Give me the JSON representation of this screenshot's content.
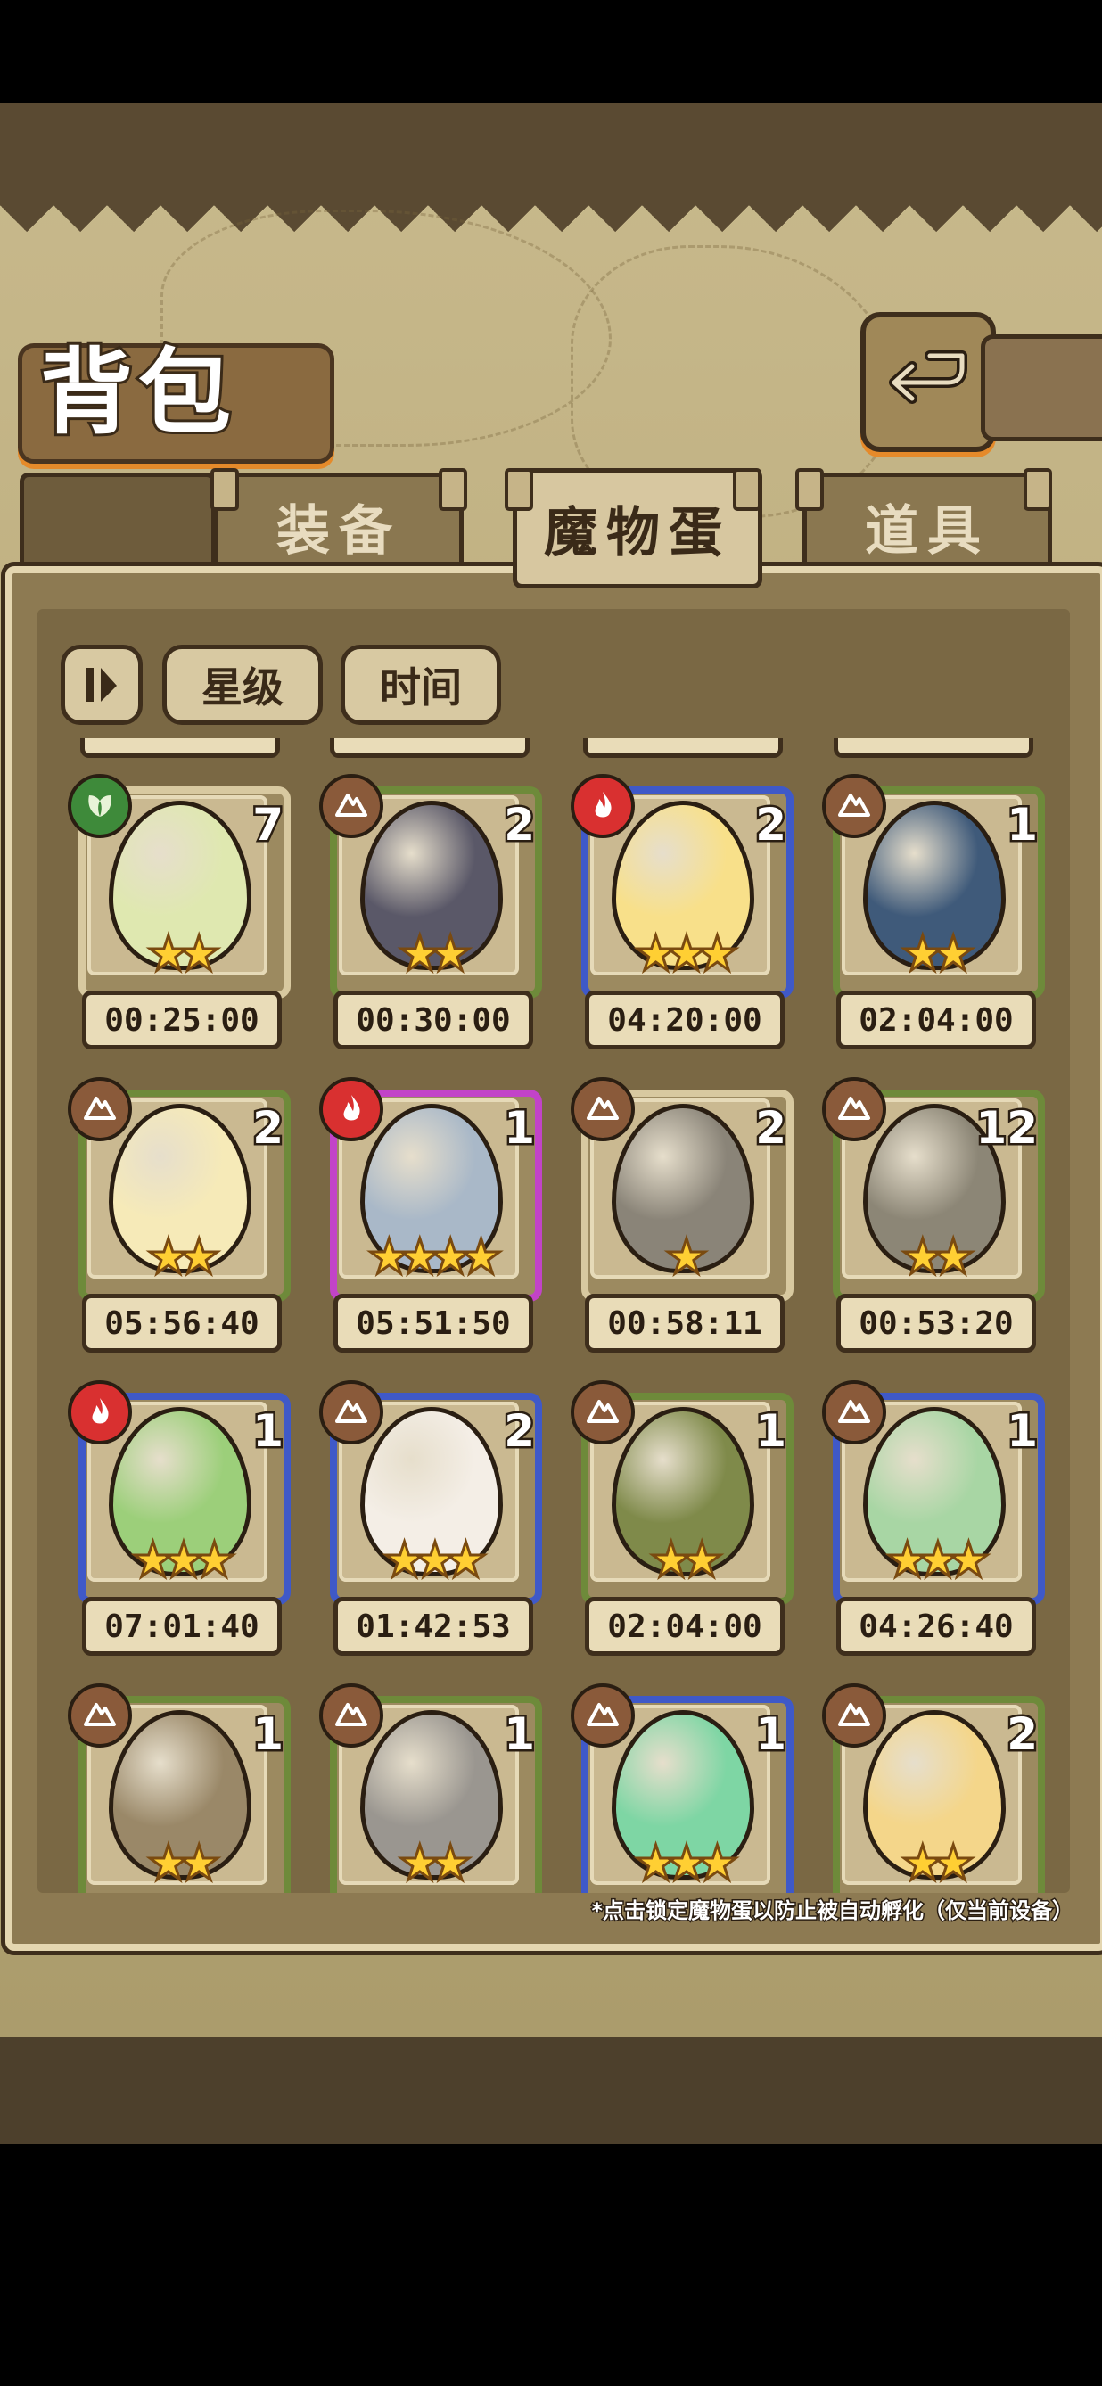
{
  "title": "背包",
  "tabs": [
    {
      "label": "装备",
      "active": false
    },
    {
      "label": "魔物蛋",
      "active": true
    },
    {
      "label": "道具",
      "active": false
    }
  ],
  "filters": {
    "sort_label": "星级",
    "time_label": "时间"
  },
  "note": "*点击锁定魔物蛋以防止被自动孵化（仅当前设备）",
  "cards": [
    {
      "count": "7",
      "stars": "★★",
      "timer": "00:25:00",
      "element": "leaf",
      "frame": "tan",
      "egg_color": "#dfe8b0"
    },
    {
      "count": "2",
      "stars": "★★",
      "timer": "00:30:00",
      "element": "earth",
      "frame": "green",
      "egg_color": "#5a5868"
    },
    {
      "count": "2",
      "stars": "★★★",
      "timer": "04:20:00",
      "element": "fire",
      "frame": "blue",
      "egg_color": "#f8e08a"
    },
    {
      "count": "1",
      "stars": "★★",
      "timer": "02:04:00",
      "element": "earth",
      "frame": "green",
      "egg_color": "#3f5a7a"
    },
    {
      "count": "2",
      "stars": "★★",
      "timer": "05:56:40",
      "element": "earth",
      "frame": "green",
      "egg_color": "#f6eab8"
    },
    {
      "count": "1",
      "stars": "★★★★",
      "timer": "05:51:50",
      "element": "fire",
      "frame": "purple",
      "egg_color": "#a9b8c8"
    },
    {
      "count": "2",
      "stars": "★",
      "timer": "00:58:11",
      "element": "earth",
      "frame": "tan",
      "egg_color": "#8a8478"
    },
    {
      "count": "12",
      "stars": "★★",
      "timer": "00:53:20",
      "element": "earth",
      "frame": "green",
      "egg_color": "#8c8676"
    },
    {
      "count": "1",
      "stars": "★★★",
      "timer": "07:01:40",
      "element": "fire",
      "frame": "blue",
      "egg_color": "#9ccf7a"
    },
    {
      "count": "2",
      "stars": "★★★",
      "timer": "01:42:53",
      "element": "earth",
      "frame": "blue",
      "egg_color": "#f4eee6"
    },
    {
      "count": "1",
      "stars": "★★",
      "timer": "02:04:00",
      "element": "earth",
      "frame": "green",
      "egg_color": "#7f8a4a"
    },
    {
      "count": "1",
      "stars": "★★★",
      "timer": "04:26:40",
      "element": "earth",
      "frame": "blue",
      "egg_color": "#a8d6a4"
    },
    {
      "count": "1",
      "stars": "★★",
      "timer": "",
      "element": "earth",
      "frame": "green",
      "egg_color": "#9a8868"
    },
    {
      "count": "1",
      "stars": "★★",
      "timer": "",
      "element": "earth",
      "frame": "green",
      "egg_color": "#9a9690"
    },
    {
      "count": "1",
      "stars": "★★★",
      "timer": "",
      "element": "earth",
      "frame": "blue",
      "egg_color": "#7ed6a4"
    },
    {
      "count": "2",
      "stars": "★★",
      "timer": "",
      "element": "earth",
      "frame": "green",
      "egg_color": "#f4d68a"
    }
  ],
  "colors": {
    "frame_green": "#6e8a3a",
    "frame_blue": "#3f59c8",
    "frame_purple": "#c243c8",
    "frame_tan": "#d8c9a0",
    "badge_fire": "#d93030",
    "badge_leaf": "#3e8a3a",
    "badge_earth": "#8a5a3a"
  }
}
